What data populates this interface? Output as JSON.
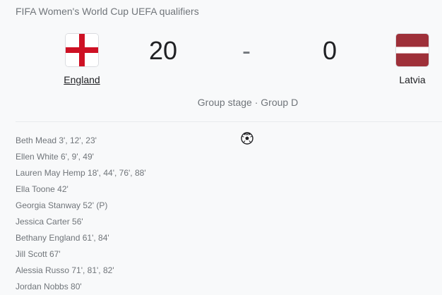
{
  "competition": "FIFA Women's World Cup UEFA qualifiers",
  "home_team": {
    "name": "England",
    "score": "20",
    "flag_icon": "england-flag-icon",
    "flag_colors": {
      "field": "#ffffff",
      "cross": "#ce1124"
    }
  },
  "away_team": {
    "name": "Latvia",
    "score": "0",
    "flag_icon": "latvia-flag-icon",
    "flag_colors": {
      "outer": "#9e3039",
      "stripe": "#ffffff"
    }
  },
  "score_separator": "-",
  "stage": "Group stage · Group D",
  "goals_icon": "soccer-ball-icon",
  "scorers": [
    "Beth Mead 3', 12', 23'",
    "Ellen White 6', 9', 49'",
    "Lauren May Hemp 18', 44', 76', 88'",
    "Ella Toone 42'",
    "Georgia Stanway 52' (P)",
    "Jessica Carter 56'",
    "Bethany England 61', 84'",
    "Jill Scott 67'",
    "Alessia Russo 71', 81', 82'",
    "Jordan Nobbs 80'"
  ]
}
